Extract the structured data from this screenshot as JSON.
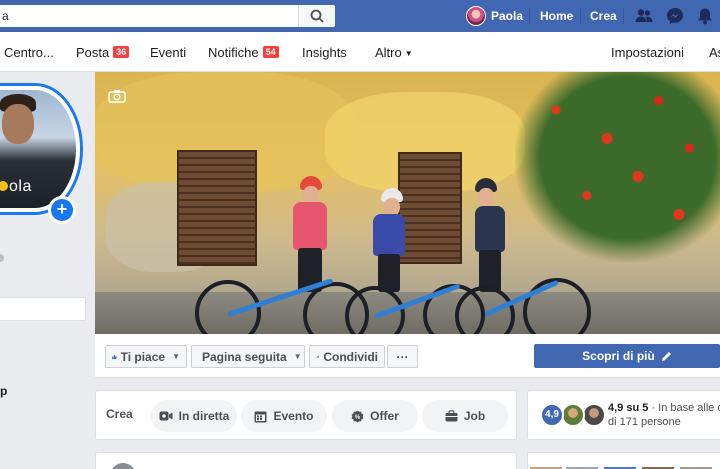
{
  "topbar": {
    "search_value": "a",
    "user_name": "Paola",
    "home_label": "Home",
    "create_label": "Crea",
    "icons": [
      "search-icon",
      "friends-icon",
      "messenger-icon",
      "notifications-bell-icon"
    ]
  },
  "page_nav": {
    "items": [
      {
        "label": "Centro..."
      },
      {
        "label": "Posta",
        "badge": "36"
      },
      {
        "label": "Eventi"
      },
      {
        "label": "Notifiche",
        "badge": "54"
      },
      {
        "label": "Insights"
      },
      {
        "label": "Altro",
        "has_caret": true
      },
      {
        "label": "Impostazioni"
      },
      {
        "label": "As"
      }
    ]
  },
  "profile": {
    "shirt_text": "ola",
    "add_icon": "plus-icon"
  },
  "left_column": {
    "partial_text": "p"
  },
  "actions": {
    "like_label": "Ti piace",
    "follow_label": "Pagina seguita",
    "share_label": "Condividi",
    "more_label": "···",
    "cta_label": "Scopri di più"
  },
  "create": {
    "label": "Crea",
    "buttons": [
      {
        "label": "In diretta",
        "icon": "live-video-icon"
      },
      {
        "label": "Evento",
        "icon": "calendar-icon"
      },
      {
        "label": "Offer",
        "icon": "offer-tag-icon"
      },
      {
        "label": "Job",
        "icon": "briefcase-icon"
      }
    ]
  },
  "rating": {
    "score": "4,9",
    "summary_bold": "4,9 su 5",
    "summary_rest": " · In base alle o",
    "subline": "di 171 persone"
  },
  "colors": {
    "brand_blue": "#4267b2",
    "badge_red": "#fa3e3e",
    "profile_ring": "#1877f2"
  }
}
